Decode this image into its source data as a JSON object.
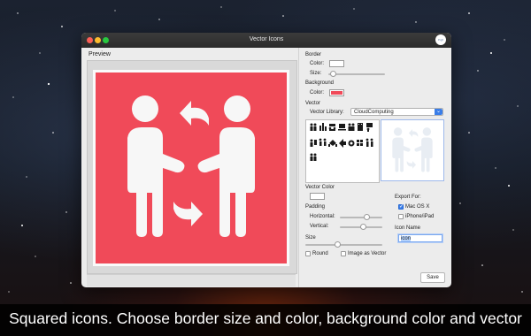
{
  "window": {
    "title": "Vector Icons",
    "avatar_text": "n.p"
  },
  "preview": {
    "label": "Preview",
    "background_color": "#f04a59",
    "figure_color": "#f7f7f7"
  },
  "border": {
    "heading": "Border",
    "color_label": "Color:",
    "color_value": "#ffffff",
    "size_label": "Size:"
  },
  "background": {
    "heading": "Background",
    "color_label": "Color:",
    "color_value": "#f04a59"
  },
  "vector": {
    "heading": "Vector",
    "library_label": "Vector Library:",
    "library_value": "CloudComputing",
    "icon_names": [
      "people-icon",
      "chart-icon",
      "meeting-icon",
      "laptop-icon",
      "team-icon",
      "building-icon",
      "presentation-icon",
      "graph-icon",
      "people-exchange-icon",
      "handshake-icon",
      "arrow-icon",
      "globe-icon",
      "grid-icon",
      "person-icon"
    ]
  },
  "vector_color": {
    "heading": "Vector Color",
    "color_value": "#ffffff"
  },
  "padding": {
    "heading": "Padding",
    "horizontal_label": "Horizontal:",
    "vertical_label": "Vertical:"
  },
  "size": {
    "heading": "Size"
  },
  "options": {
    "round_label": "Round",
    "round_checked": false,
    "image_as_vector_label": "Image as Vector",
    "image_as_vector_checked": false
  },
  "export": {
    "heading": "Export For:",
    "mac_label": "Mac OS X",
    "mac_checked": true,
    "iphone_label": "iPhone/iPad",
    "iphone_checked": false
  },
  "icon_name": {
    "heading": "Icon Name",
    "value": "icon"
  },
  "save_label": "Save",
  "caption": "Squared icons. Choose border size and color, background color and vector",
  "accent_color": "#3b7ee8"
}
